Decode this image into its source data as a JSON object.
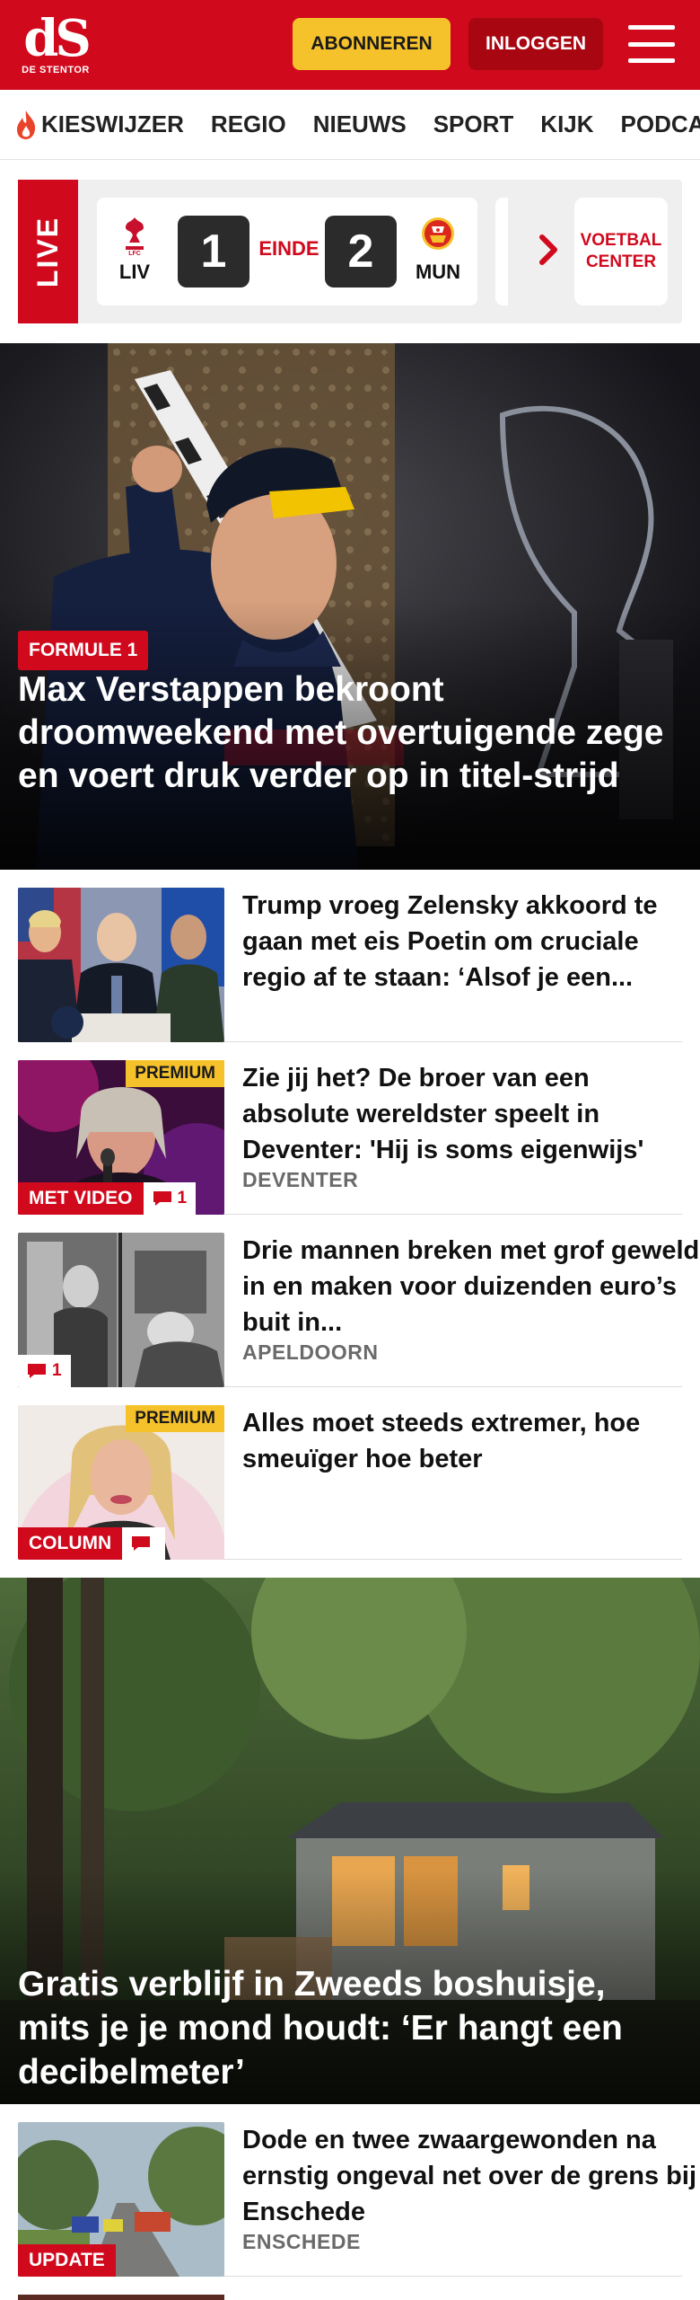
{
  "header": {
    "logo_mark": "dS",
    "logo_name": "DE STENTOR",
    "subscribe_label": "ABONNEREN",
    "login_label": "INLOGGEN",
    "colors": {
      "brand": "#d0091d",
      "subscribe": "#f6c22b",
      "login": "#a80712"
    }
  },
  "nav": {
    "items": [
      "KIESWIJZER",
      "REGIO",
      "NIEUWS",
      "SPORT",
      "KIJK",
      "PODCAS"
    ]
  },
  "live": {
    "tag": "LIVE",
    "home_team": "LIV",
    "home_score": "1",
    "status": "EINDE",
    "away_score": "2",
    "away_team": "MUN",
    "voetbal_center": "VOETBAL CENTER"
  },
  "hero": {
    "label": "FORMULE 1",
    "title": "Max Verstappen bekroont droomweekend met overtuigende zege en voert druk verder op in titel-strijd"
  },
  "articles": [
    {
      "title": "Trump vroeg Zelensky akkoord te gaan met eis Poetin om cruciale regio af te staan: ‘Alsof je een...",
      "location": "",
      "premium": "",
      "tag": "",
      "comments": ""
    },
    {
      "title": "Zie jij het? De broer van een absolute wereldster speelt in Deventer: 'Hij is soms eigenwijs'",
      "location": "DEVENTER",
      "premium": "PREMIUM",
      "tag": "MET VIDEO",
      "comments": "1"
    },
    {
      "title": "Drie mannen breken met grof geweld in en maken voor duizenden euro’s buit in...",
      "location": "APELDOORN",
      "premium": "",
      "tag": "",
      "comments": "1"
    },
    {
      "title": "Alles moet steeds extremer, hoe smeuïger hoe beter",
      "location": "",
      "premium": "PREMIUM",
      "tag": "COLUMN",
      "comments": ""
    }
  ],
  "hero2": {
    "title": "Gratis verblijf in Zweeds boshuisje, mits je je mond houdt: ‘Er hangt een decibelmeter’"
  },
  "articles2": [
    {
      "title": "Dode en twee zwaargewonden na ernstig ongeval net over de grens bij Enschede",
      "location": "ENSCHEDE",
      "tag": "UPDATE"
    }
  ]
}
